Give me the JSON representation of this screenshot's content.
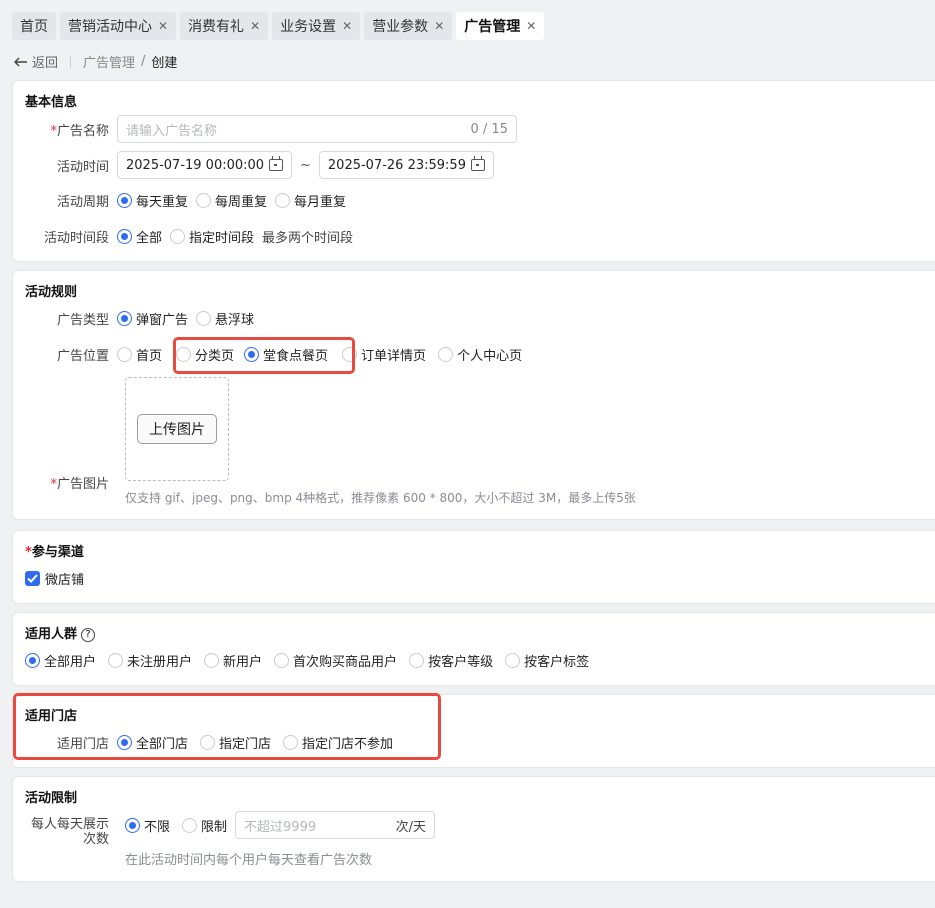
{
  "tabs": [
    {
      "label": "首页",
      "closable": false
    },
    {
      "label": "营销活动中心",
      "closable": true
    },
    {
      "label": "消费有礼",
      "closable": true
    },
    {
      "label": "业务设置",
      "closable": true
    },
    {
      "label": "营业参数",
      "closable": true
    },
    {
      "label": "广告管理",
      "closable": true,
      "active": true
    }
  ],
  "breadcrumb": {
    "back": "返回",
    "parent": "广告管理",
    "current": "创建"
  },
  "basic": {
    "title": "基本信息",
    "name_label": "广告名称",
    "name_placeholder": "请输入广告名称",
    "name_count": "0 / 15",
    "time_label": "活动时间",
    "start": "2025-07-19 00:00:00",
    "end": "2025-07-26 23:59:59",
    "tilde": "~",
    "cycle_label": "活动周期",
    "cycle_options": [
      "每天重复",
      "每周重复",
      "每月重复"
    ],
    "period_label": "活动时间段",
    "period_options": [
      "全部",
      "指定时间段"
    ],
    "period_hint": "最多两个时间段"
  },
  "rules": {
    "title": "活动规则",
    "type_label": "广告类型",
    "type_options": [
      "弹窗广告",
      "悬浮球"
    ],
    "position_label": "广告位置",
    "position_options": [
      "首页",
      "分类页",
      "堂食点餐页",
      "订单详情页",
      "个人中心页"
    ],
    "upload_label": "上传图片",
    "image_label": "广告图片",
    "image_hint": "仅支持 gif、jpeg、png、bmp 4种格式，推荐像素 600 * 800，大小不超过 3M，最多上传5张"
  },
  "channel": {
    "title": "参与渠道",
    "option": "微店铺"
  },
  "crowd": {
    "title": "适用人群",
    "help": "?",
    "options": [
      "全部用户",
      "未注册用户",
      "新用户",
      "首次购买商品用户",
      "按客户等级",
      "按客户标签"
    ]
  },
  "store": {
    "title": "适用门店",
    "label": "适用门店",
    "options": [
      "全部门店",
      "指定门店",
      "指定门店不参加"
    ]
  },
  "limit": {
    "title": "活动限制",
    "label_1": "每人每天展示",
    "label_2": "次数",
    "options": [
      "不限",
      "限制"
    ],
    "placeholder": "不超过9999",
    "unit": "次/天",
    "hint": "在此活动时间内每个用户每天查看广告次数"
  },
  "colors": {
    "primary": "#2f6bf0",
    "highlight": "#e84a3f",
    "required": "#e23333"
  },
  "selected": {
    "cycle": "每天重复",
    "period": "全部",
    "type": "弹窗广告",
    "position": "堂食点餐页",
    "crowd": "全部用户",
    "store": "全部门店",
    "limit": "不限"
  }
}
